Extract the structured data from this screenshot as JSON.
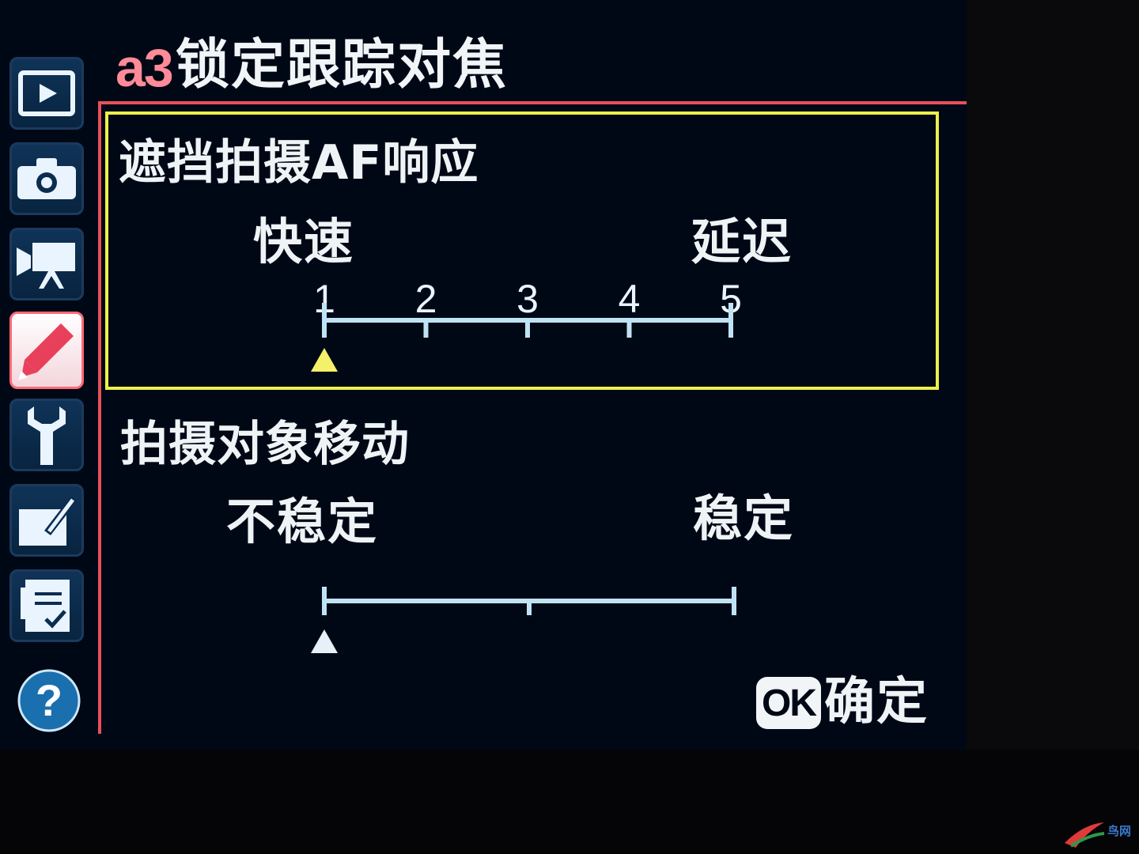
{
  "menu": {
    "code": "a3",
    "title": "锁定跟踪对焦"
  },
  "sidebar": {
    "items": [
      {
        "icon": "playback-icon"
      },
      {
        "icon": "camera-icon"
      },
      {
        "icon": "movie-icon"
      },
      {
        "icon": "pencil-icon",
        "active": true
      },
      {
        "icon": "wrench-icon"
      },
      {
        "icon": "retouch-icon"
      },
      {
        "icon": "my-menu-icon"
      },
      {
        "icon": "help-icon"
      }
    ]
  },
  "setting1": {
    "title": "遮挡拍摄AF响应",
    "left_label": "快速",
    "right_label": "延迟",
    "ticks": [
      "1",
      "2",
      "3",
      "4",
      "5"
    ],
    "selected_index": 0
  },
  "setting2": {
    "title": "拍摄对象移动",
    "left_label": "不稳定",
    "right_label": "稳定",
    "positions": 3,
    "selected_index": 0
  },
  "footer": {
    "ok_badge": "OK",
    "ok_label": "确定"
  },
  "watermark": {
    "text": "鸟网"
  },
  "colors": {
    "screen_bg": "#000816",
    "highlight_border": "#ecf04a",
    "accent_red": "#e8505c",
    "scale_line": "#bfe3f5",
    "selected_marker": "#f4f06a"
  }
}
